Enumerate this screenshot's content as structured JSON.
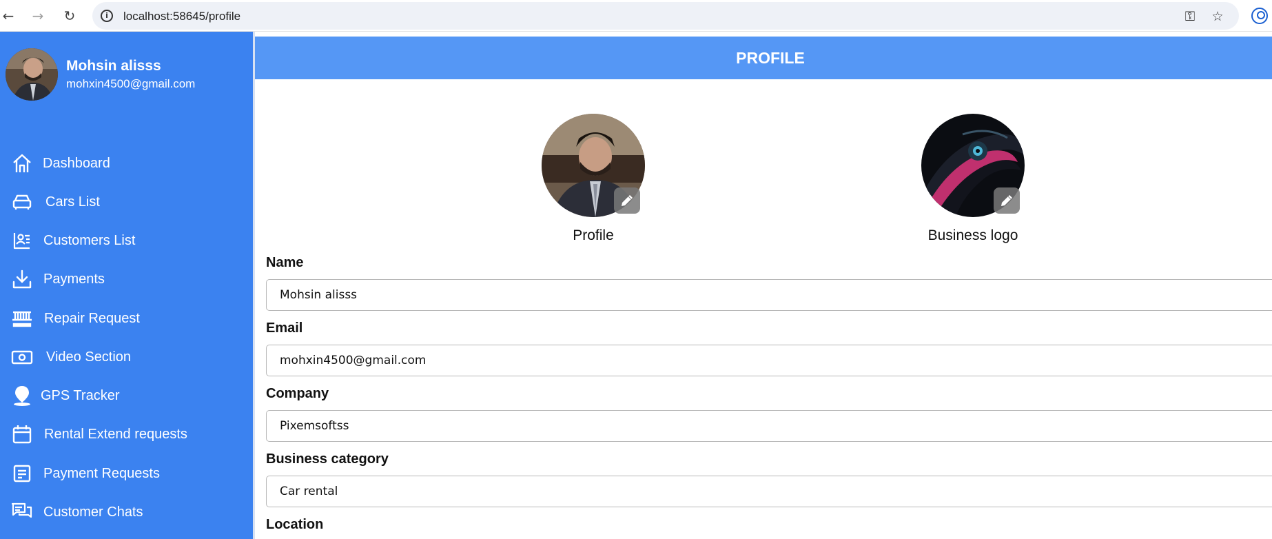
{
  "browser": {
    "url": "localhost:58645/profile",
    "info_glyph": "i",
    "back_glyph": "←",
    "forward_glyph": "→",
    "reload_glyph": "↻",
    "key_glyph": "⚿",
    "star_glyph": "☆"
  },
  "sidebar": {
    "user_name": "Mohsin alisss",
    "user_email": "mohxin4500@gmail.com",
    "items": [
      {
        "label": "Dashboard",
        "icon": "home-icon"
      },
      {
        "label": "Cars List",
        "icon": "car-icon"
      },
      {
        "label": "Customers List",
        "icon": "customers-icon"
      },
      {
        "label": "Payments",
        "icon": "download-icon"
      },
      {
        "label": "Repair Request",
        "icon": "repair-icon"
      },
      {
        "label": "Video Section",
        "icon": "video-icon"
      },
      {
        "label": "GPS Tracker",
        "icon": "location-pin-icon"
      },
      {
        "label": "Rental Extend requests",
        "icon": "calendar-icon"
      },
      {
        "label": "Payment Requests",
        "icon": "document-icon"
      },
      {
        "label": "Customer Chats",
        "icon": "chat-icon"
      }
    ]
  },
  "main": {
    "header_title": "PROFILE",
    "photos": {
      "profile_caption": "Profile",
      "business_caption": "Business logo"
    },
    "fields": [
      {
        "label": "Name",
        "value": "Mohsin alisss"
      },
      {
        "label": "Email",
        "value": "mohxin4500@gmail.com"
      },
      {
        "label": "Company",
        "value": "Pixemsoftss"
      },
      {
        "label": "Business category",
        "value": "Car rental"
      },
      {
        "label": "Location",
        "value": ""
      }
    ]
  },
  "colors": {
    "sidebar_bg": "#3b82f0",
    "header_bg": "#5597f5"
  }
}
